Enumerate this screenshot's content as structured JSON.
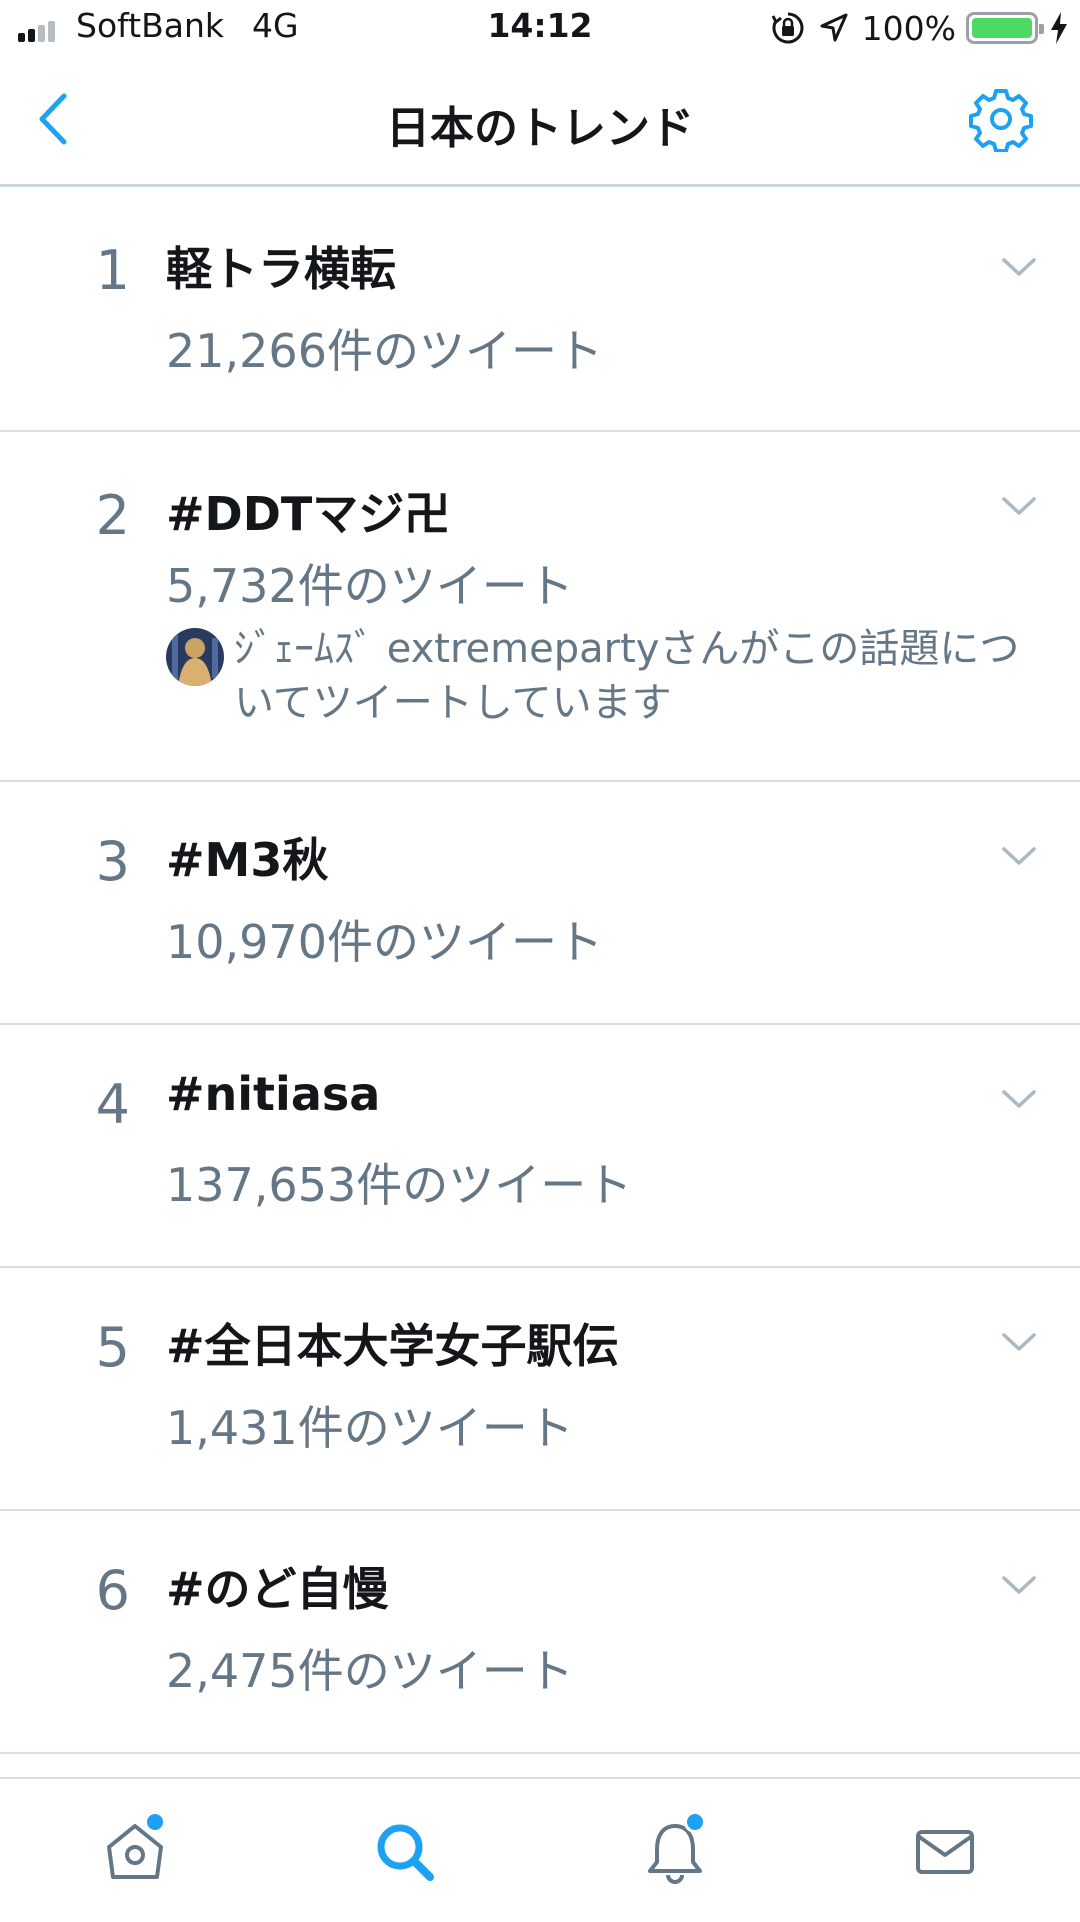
{
  "status_bar": {
    "carrier": "SoftBank",
    "network": "4G",
    "time": "14:12",
    "battery_percent": "100%",
    "battery_level": 1.0,
    "icons": [
      "signal-icon",
      "orientation-lock-icon",
      "location-arrow-icon",
      "battery-icon",
      "charging-bolt-icon"
    ]
  },
  "nav": {
    "title": "日本のトレンド",
    "back_icon": "chevron-left-icon",
    "settings_icon": "gear-icon"
  },
  "trends": [
    {
      "rank": "1",
      "name": "軽トラ横転",
      "count": "21,266件のツイート"
    },
    {
      "rank": "2",
      "name": "#DDTマジ卍",
      "count": "5,732件のツイート",
      "context": "ｼﾞｪｰﾑｽﾞ extremepartyさんがこの話題についてツイートしています"
    },
    {
      "rank": "3",
      "name": "#M3秋",
      "count": "10,970件のツイート"
    },
    {
      "rank": "4",
      "name": "#nitiasa",
      "count": "137,653件のツイート"
    },
    {
      "rank": "5",
      "name": "#全日本大学女子駅伝",
      "count": "1,431件のツイート"
    },
    {
      "rank": "6",
      "name": "#のど自慢",
      "count": "2,475件のツイート"
    }
  ],
  "tab_bar": {
    "tabs": [
      {
        "icon": "home-icon",
        "selected": false,
        "badge": true
      },
      {
        "icon": "search-icon",
        "selected": true,
        "badge": false
      },
      {
        "icon": "notifications-bell-icon",
        "selected": false,
        "badge": true
      },
      {
        "icon": "messages-envelope-icon",
        "selected": false,
        "badge": false
      }
    ]
  },
  "colors": {
    "accent": "#1da1f2",
    "text_primary": "#14171a",
    "text_secondary": "#657786",
    "divider": "#d8dee3",
    "battery_fill": "#4cd964"
  }
}
